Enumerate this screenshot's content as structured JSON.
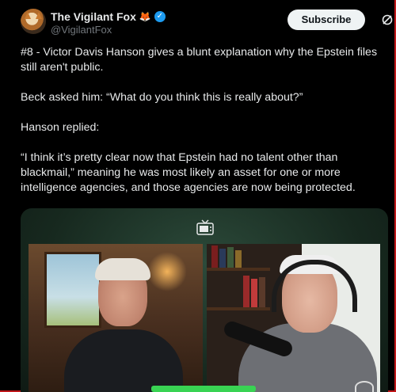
{
  "post": {
    "author": {
      "display_name": "The Vigilant Fox",
      "name_emoji": "🦊",
      "verified_icon": "verified-badge-icon",
      "handle": "@VigilantFox"
    },
    "actions": {
      "subscribe_label": "Subscribe",
      "grok_icon": "grok-icon",
      "more_icon": "more-icon",
      "more_glyph": "···"
    },
    "paragraphs": [
      "#8 - Victor Davis Hanson gives a blunt explanation why the Epstein files still aren't public.",
      "Beck asked him: “What do you think this is really about?”",
      "Hanson replied:",
      "“I think it’s pretty clear now that Epstein had no talent other than blackmail,” meaning he was most likely an asset for one or more intelligence agencies, and those agencies are now being protected."
    ],
    "media": {
      "type": "video",
      "tv_icon": "tv-icon",
      "accent_color": "#39d353"
    }
  },
  "colors": {
    "background": "#000000",
    "text": "#e7e9ea",
    "muted": "#71767b",
    "verified": "#1d9bf0",
    "frame_border": "#c0171a"
  }
}
